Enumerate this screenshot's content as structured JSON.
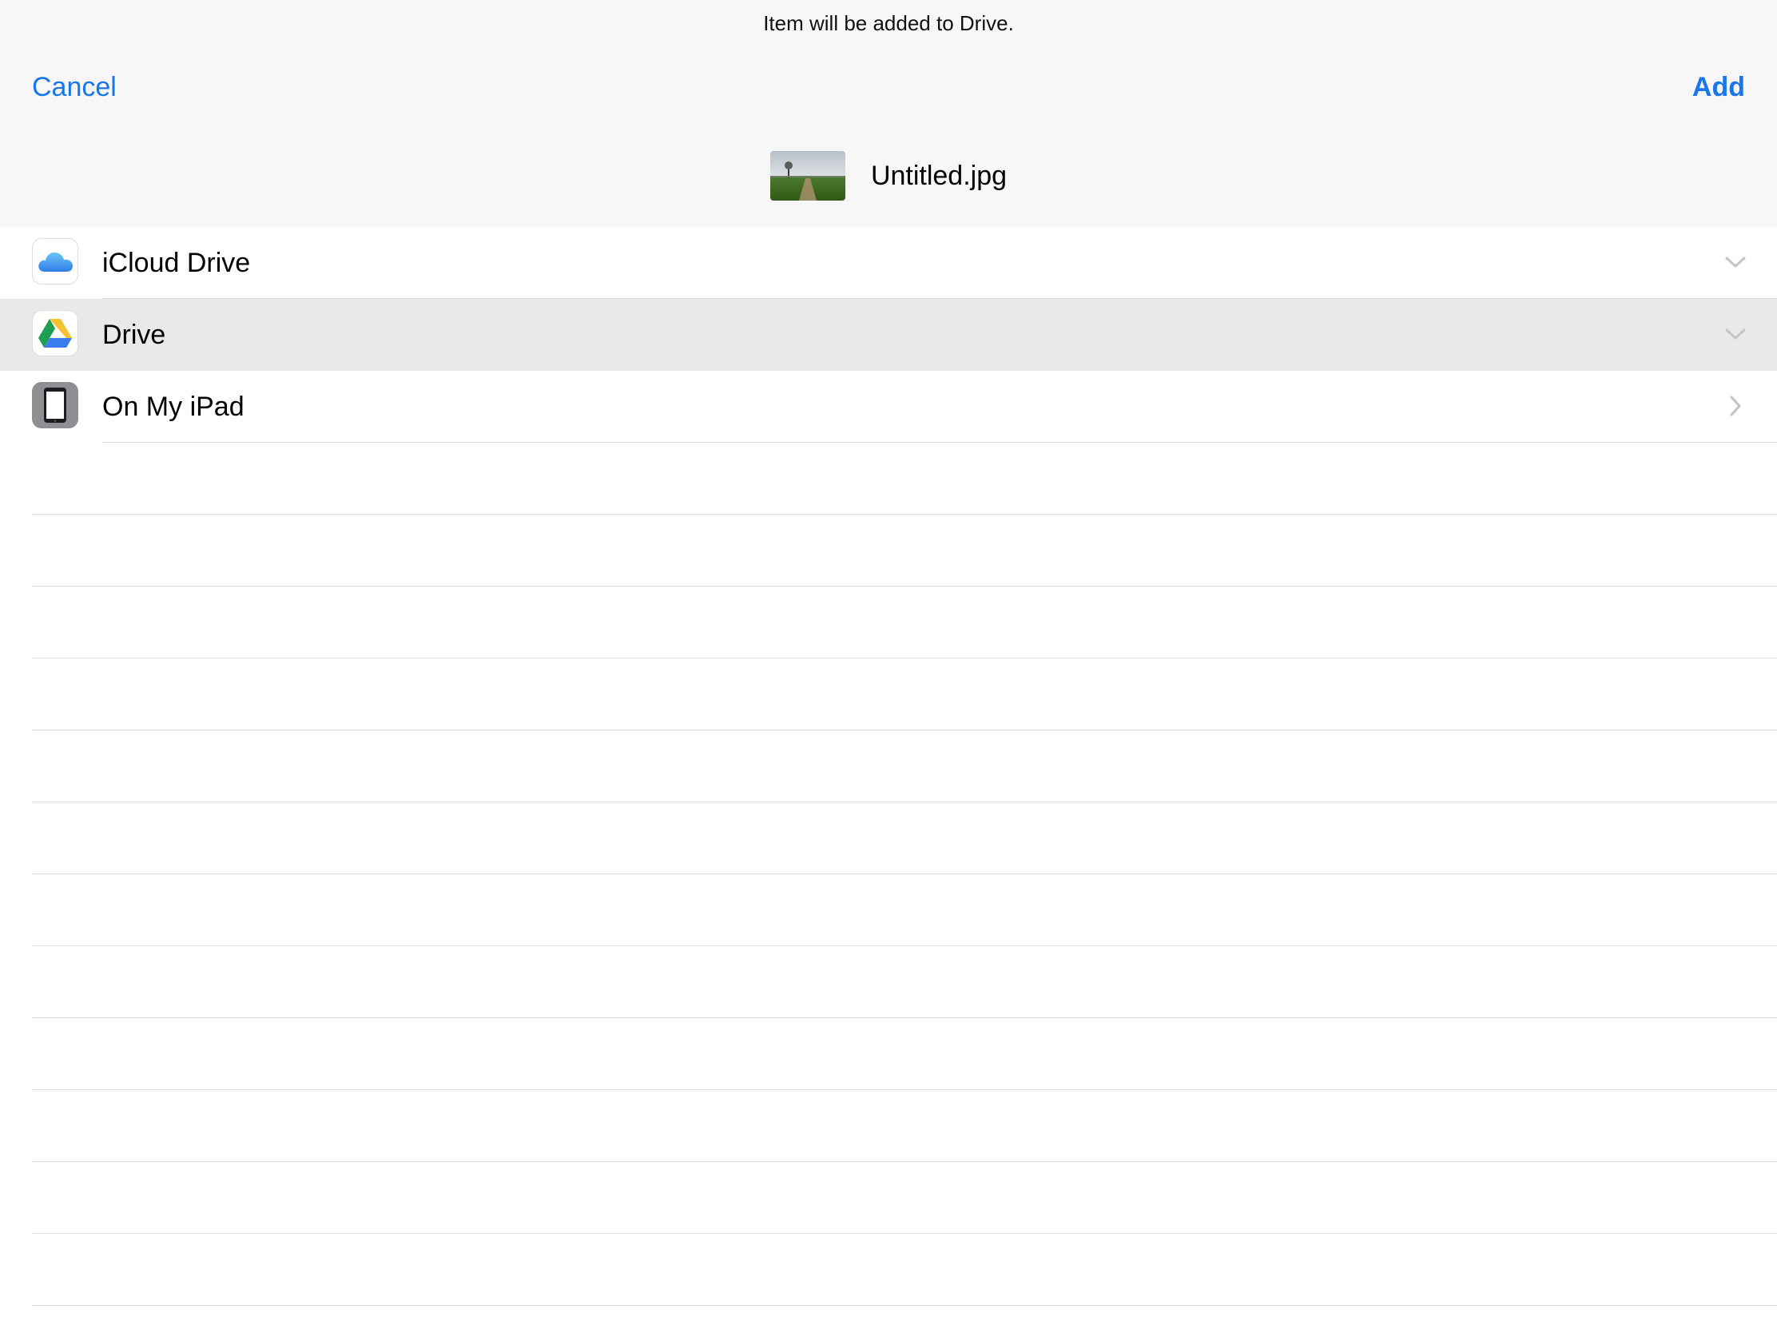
{
  "header": {
    "subtitle": "Item will be added to Drive.",
    "cancel_label": "Cancel",
    "add_label": "Add",
    "file_name": "Untitled.jpg",
    "file_thumbnail": "field-with-tree-photo"
  },
  "locations": [
    {
      "label": "iCloud Drive",
      "icon": "icloud-icon",
      "accessory": "chevron-down-icon",
      "selected": false
    },
    {
      "label": "Drive",
      "icon": "google-drive-icon",
      "accessory": "chevron-down-icon",
      "selected": true
    },
    {
      "label": "On My iPad",
      "icon": "ipad-icon",
      "accessory": "chevron-right-icon",
      "selected": false
    }
  ],
  "colors": {
    "accent": "#1a76ea",
    "header_bg": "#f7f7f7",
    "selected_row_bg": "#e9e9e9"
  }
}
